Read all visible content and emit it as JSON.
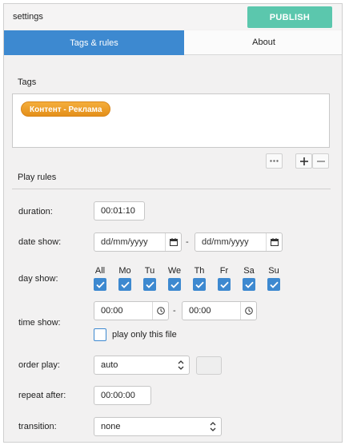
{
  "header": {
    "title": "settings",
    "publish_label": "PUBLISH"
  },
  "tabs": [
    {
      "label": "Tags & rules",
      "active": true
    },
    {
      "label": "About",
      "active": false
    }
  ],
  "tags_section": {
    "label": "Tags",
    "tags": [
      "Контент - Реклама"
    ]
  },
  "tag_buttons": {
    "more": "···",
    "add": "+",
    "remove": "−"
  },
  "play_rules": {
    "label": "Play rules",
    "duration": {
      "label": "duration:",
      "value": "00:01:10"
    },
    "date_show": {
      "label": "date show:",
      "from_placeholder": "dd/mm/yyyy",
      "separator": "-",
      "to_placeholder": "dd/mm/yyyy"
    },
    "day_show": {
      "label": "day show:",
      "days": [
        {
          "name": "All",
          "checked": true
        },
        {
          "name": "Mo",
          "checked": true
        },
        {
          "name": "Tu",
          "checked": true
        },
        {
          "name": "We",
          "checked": true
        },
        {
          "name": "Th",
          "checked": true
        },
        {
          "name": "Fr",
          "checked": true
        },
        {
          "name": "Sa",
          "checked": true
        },
        {
          "name": "Su",
          "checked": true
        }
      ]
    },
    "time_show": {
      "label": "time show:",
      "from": "00:00",
      "separator": "-",
      "to": "00:00",
      "only_this_file_label": "play only this file",
      "only_this_file_checked": false
    },
    "order_play": {
      "label": "order play:",
      "value": "auto"
    },
    "repeat_after": {
      "label": "repeat after:",
      "value": "00:00:00"
    },
    "transition": {
      "label": "transition:",
      "value": "none"
    }
  },
  "colors": {
    "accent": "#3d89d0",
    "publish": "#5bc7ad",
    "tag": "#e9961f"
  }
}
